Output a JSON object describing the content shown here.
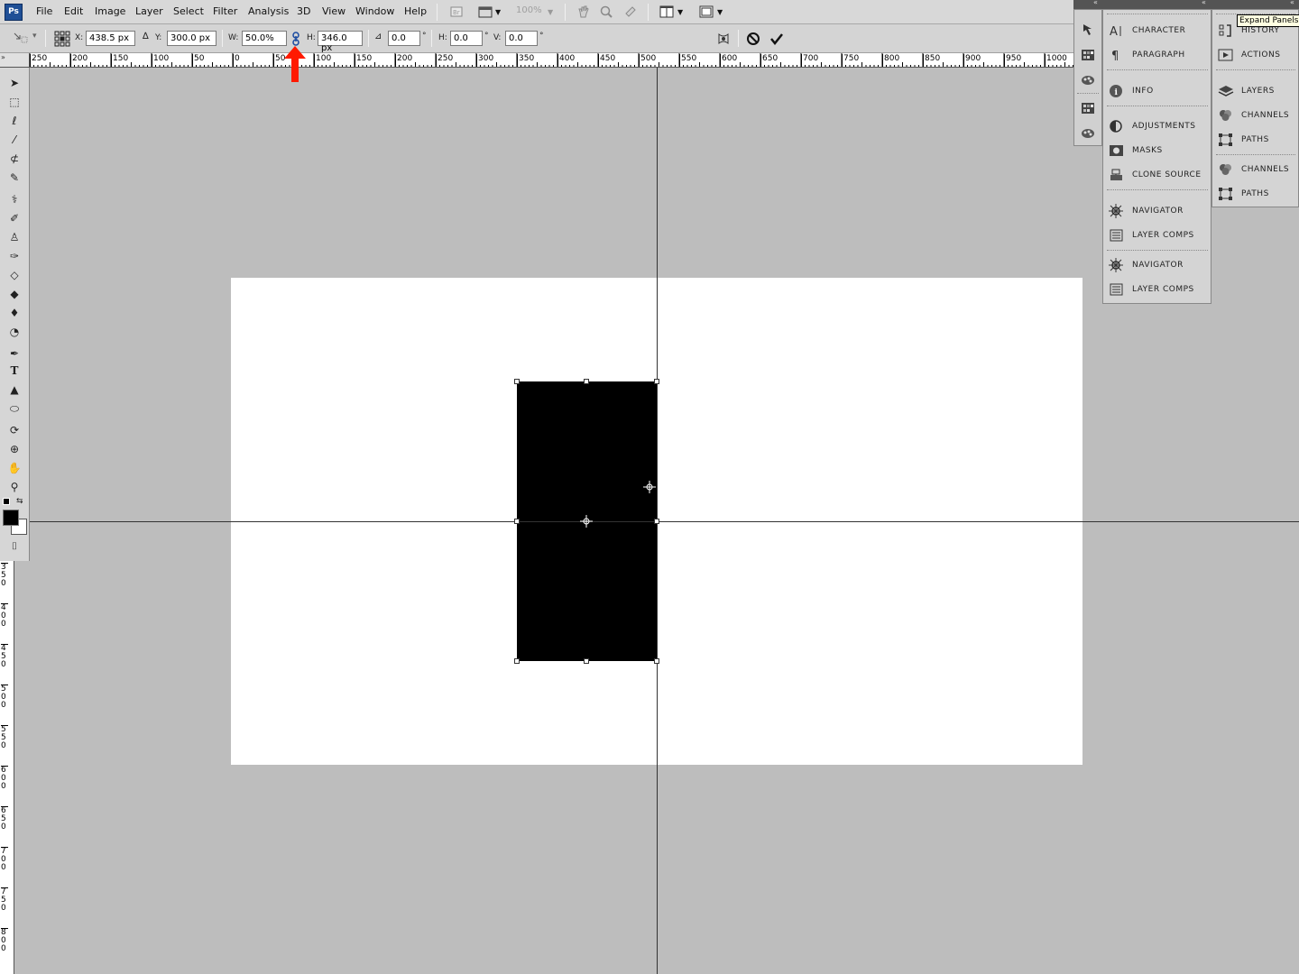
{
  "app": {
    "logo": "Ps"
  },
  "menu": [
    "File",
    "Edit",
    "Image",
    "Layer",
    "Select",
    "Filter",
    "Analysis",
    "3D",
    "View",
    "Window",
    "Help"
  ],
  "menubar": {
    "zoom": "100%"
  },
  "options": {
    "x_label": "X:",
    "x_value": "438.5 px",
    "y_label": "Y:",
    "y_value": "300.0 px",
    "w_label": "W:",
    "w_value": "50.0%",
    "h_label": "H:",
    "h_value": "346.0 px",
    "angle_value": "0.0",
    "hskew_label": "H:",
    "hskew_value": "0.0",
    "vskew_label": "V:",
    "vskew_value": "0.0",
    "deg": "°"
  },
  "ruler": {
    "labels": [
      "250",
      "200",
      "150",
      "100",
      "50",
      "0",
      "50",
      "100",
      "150",
      "200",
      "250",
      "300",
      "350",
      "400",
      "450",
      "500",
      "550",
      "600",
      "650",
      "700",
      "750",
      "800",
      "850",
      "900",
      "950",
      "1000"
    ]
  },
  "vruler": {
    "labels": [
      "350",
      "400",
      "450",
      "500",
      "550",
      "600",
      "650",
      "700",
      "750",
      "800"
    ]
  },
  "panels": {
    "col1": [
      "CHARACTER",
      "PARAGRAPH",
      "INFO",
      "ADJUSTMENTS",
      "MASKS",
      "CLONE SOURCE",
      "NAVIGATOR",
      "LAYER COMPS",
      "NAVIGATOR",
      "LAYER COMPS"
    ],
    "col2": [
      "HISTORY",
      "ACTIONS",
      "LAYERS",
      "CHANNELS",
      "PATHS",
      "CHANNELS",
      "PATHS"
    ]
  },
  "tooltip": "Expand Panels",
  "colors": {
    "accent": "#ff1a00",
    "canvas": "#ffffff",
    "workspace": "#bdbdbd",
    "shape": "#000000"
  }
}
